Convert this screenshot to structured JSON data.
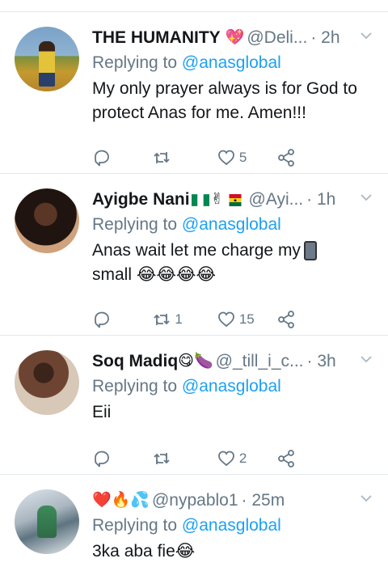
{
  "tweets": [
    {
      "name": "THE HUMANITY",
      "name_emojis": "💖",
      "handle": "@Deli...",
      "time": "· 2h",
      "replying_prefix": "Replying to",
      "replying_to": "@anasglobal",
      "text": "My only prayer always is for God to protect Anas for me. Amen!!!",
      "retweets": "",
      "likes": "5"
    },
    {
      "name": "Ayigbe Nani",
      "name_emojis": "✌",
      "handle": "@Ayi...",
      "time": "· 1h",
      "replying_prefix": "Replying to",
      "replying_to": "@anasglobal",
      "text_line1": "Anas wait let me charge my",
      "text_line2": "small",
      "text_line2_emojis": "😂😂😂😂",
      "retweets": "1",
      "likes": "15"
    },
    {
      "name": "Soq Madiq",
      "name_emojis": "😋🍆",
      "handle": "@_till_i_c...",
      "time": "· 3h",
      "replying_prefix": "Replying to",
      "replying_to": "@anasglobal",
      "text": "Eii",
      "retweets": "",
      "likes": "2"
    },
    {
      "name_emojis": "❤️🔥💦",
      "handle": "@nypablo1",
      "time": "· 25m",
      "replying_prefix": "Replying to",
      "replying_to": "@anasglobal",
      "text": "3ka aba fie",
      "text_emojis": "😂"
    }
  ],
  "colors": {
    "accent": "#1da1f2",
    "muted": "#657786",
    "divider": "#e1e8ed"
  },
  "icons": [
    "chevron-down-icon",
    "reply-icon",
    "retweet-icon",
    "like-icon",
    "share-icon"
  ]
}
